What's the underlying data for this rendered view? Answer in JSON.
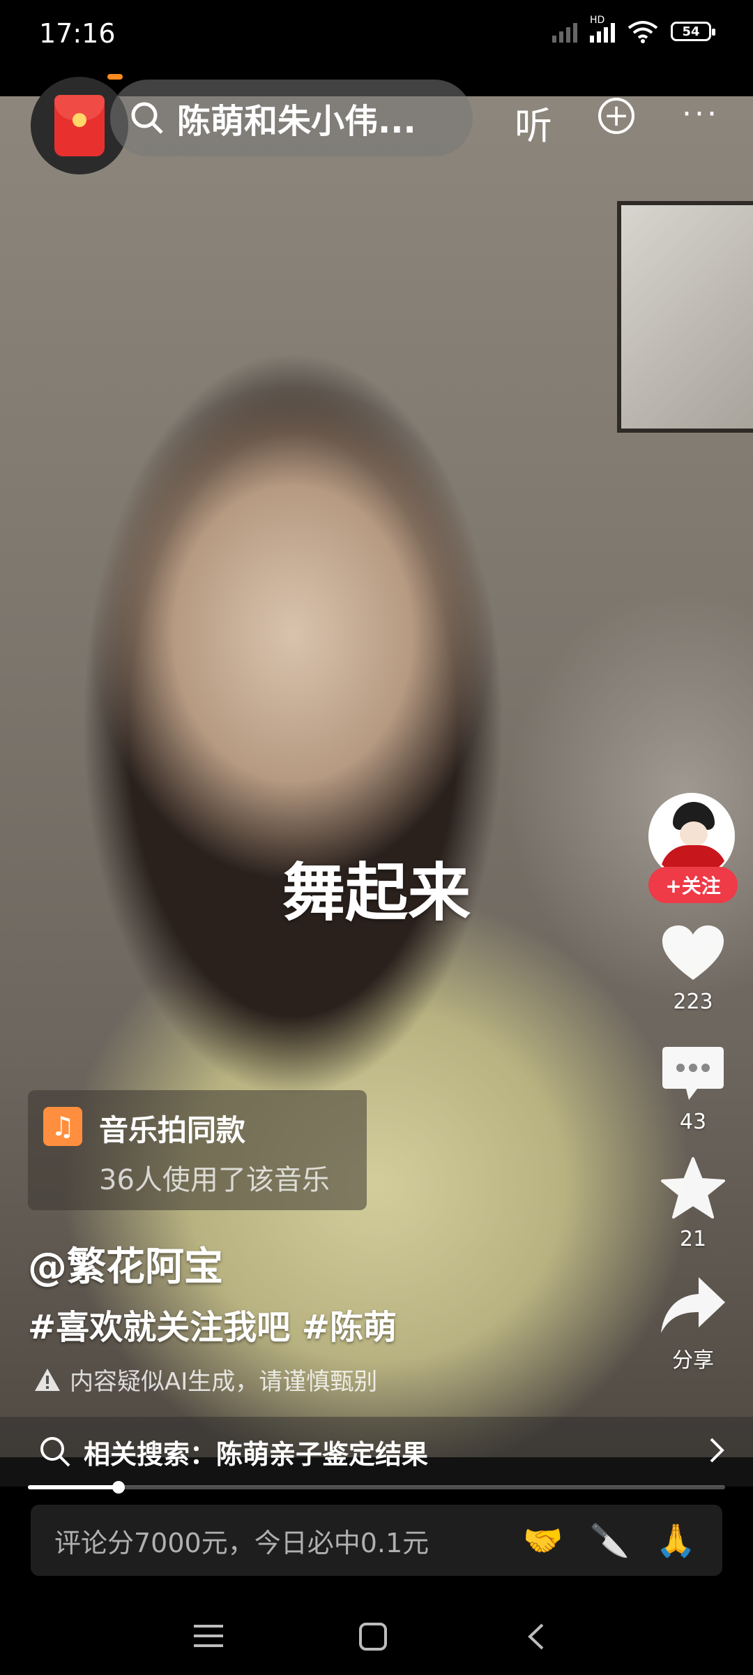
{
  "status_bar": {
    "time": "17:16",
    "network_badge": "HD",
    "battery": "54",
    "icons": [
      "signal-dim-icon",
      "signal-hd-icon",
      "wifi-icon",
      "battery-icon"
    ]
  },
  "top_bar": {
    "search_query": "陈萌和朱小伟...",
    "listen_label": "听",
    "icons": [
      "back-icon",
      "red-packet-icon",
      "search-icon",
      "plus-icon",
      "more-icon"
    ]
  },
  "video": {
    "caption": "舞起来"
  },
  "actions": {
    "follow_label": "+关注",
    "like_count": "223",
    "comment_count": "43",
    "favorite_count": "21",
    "share_label": "分享"
  },
  "music": {
    "title": "音乐拍同款",
    "subtitle": "36人使用了该音乐"
  },
  "post": {
    "author": "@繁花阿宝",
    "tags": "#喜欢就关注我吧 #陈萌",
    "ai_notice": "内容疑似AI生成，请谨慎甄别"
  },
  "related_search": {
    "text": "相关搜索：陈萌亲子鉴定结果"
  },
  "progress": {
    "fraction": 0.13
  },
  "comment_bar": {
    "placeholder": "评论分7000元，今日必中0.1元",
    "emojis": [
      "🤝",
      "🔪",
      "🙏"
    ]
  },
  "nav_bar": {
    "icons": [
      "menu-icon",
      "home-icon",
      "back-icon"
    ]
  },
  "colors": {
    "follow": "#ef3a48",
    "music_icon": "#ff8f3e",
    "red_packet": "#e8312f"
  }
}
